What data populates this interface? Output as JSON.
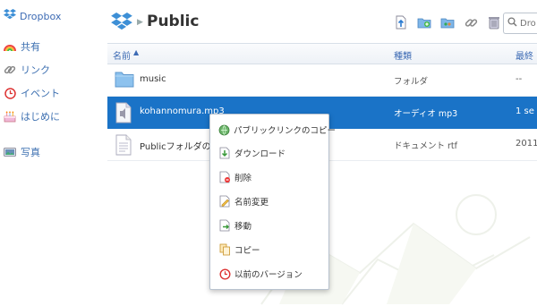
{
  "sidebar": {
    "brand": "Dropbox",
    "items": [
      {
        "label": "共有",
        "icon": "rainbow-icon"
      },
      {
        "label": "リンク",
        "icon": "chain-link-icon"
      },
      {
        "label": "イベント",
        "icon": "clock-icon"
      },
      {
        "label": "はじめに",
        "icon": "cake-icon"
      },
      {
        "label": "写真",
        "icon": "photo-icon"
      }
    ]
  },
  "header": {
    "title": "Public",
    "search_placeholder": "Dro"
  },
  "table": {
    "columns": {
      "name": "名前",
      "kind": "種類",
      "modified": "最終"
    },
    "rows": [
      {
        "name": "music",
        "kind": "フォルダ",
        "modified": "--",
        "icon": "folder-icon"
      },
      {
        "name": "kohannomura.mp3",
        "kind": "オーディオ  mp3",
        "modified": "1 se",
        "icon": "audio-file-icon"
      },
      {
        "name": "Publicフォルダの使",
        "kind": "ドキュメント  rtf",
        "modified": "2011",
        "icon": "document-icon"
      }
    ]
  },
  "context_menu": {
    "items": [
      {
        "label": "パブリックリンクのコピー",
        "icon": "link-globe-icon"
      },
      {
        "label": "ダウンロード",
        "icon": "download-icon"
      },
      {
        "label": "削除",
        "icon": "delete-icon"
      },
      {
        "label": "名前変更",
        "icon": "rename-icon"
      },
      {
        "label": "移動",
        "icon": "move-icon"
      },
      {
        "label": "コピー",
        "icon": "copy-icon"
      },
      {
        "label": "以前のバージョン",
        "icon": "history-icon"
      }
    ]
  },
  "colors": {
    "accent": "#1a73c7",
    "link": "#3d6bb4"
  }
}
